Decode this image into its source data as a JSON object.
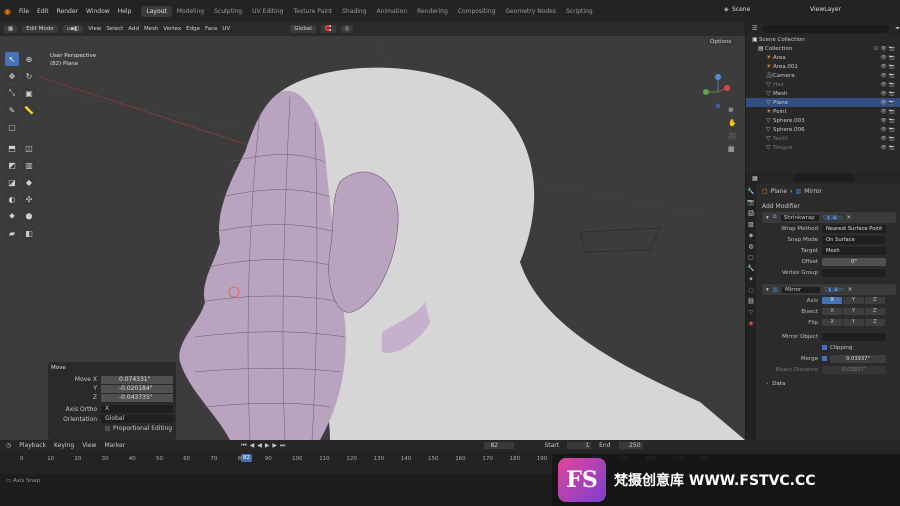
{
  "topbar": {
    "menus": [
      "File",
      "Edit",
      "Render",
      "Window",
      "Help"
    ],
    "workspaces": [
      "Layout",
      "Modeling",
      "Sculpting",
      "UV Editing",
      "Texture Paint",
      "Shading",
      "Animation",
      "Rendering",
      "Compositing",
      "Geometry Nodes",
      "Scripting"
    ],
    "active_workspace": "Layout",
    "scene_label": "Scene",
    "viewlayer_label": "ViewLayer"
  },
  "viewport": {
    "mode": "Edit Mode",
    "menus": [
      "View",
      "Select",
      "Add",
      "Mesh",
      "Vertex",
      "Edge",
      "Face",
      "UV"
    ],
    "orientation": "Global",
    "options_label": "Options",
    "view_name": "User Perspective",
    "object_name": "(82) Plane"
  },
  "operator_panel": {
    "title": "Move",
    "move_x_label": "Move X",
    "move_x": "0.074331\"",
    "y_label": "Y",
    "y": "-0.020184\"",
    "z_label": "Z",
    "z": "-0.043735\"",
    "axis_ortho_label": "Axis Ortho",
    "axis_ortho": "X",
    "orientation_label": "Orientation",
    "orientation": "Global",
    "proportional_label": "Proportional Editing"
  },
  "outliner": {
    "title": "Scene Collection",
    "collection": "Collection",
    "items": [
      {
        "name": "Area",
        "sel": false,
        "dim": false
      },
      {
        "name": "Area.001",
        "sel": false,
        "dim": false
      },
      {
        "name": "Camera",
        "sel": false,
        "dim": false
      },
      {
        "name": "Hair",
        "sel": false,
        "dim": true
      },
      {
        "name": "Mesh",
        "sel": false,
        "dim": false
      },
      {
        "name": "Plane",
        "sel": true,
        "dim": false
      },
      {
        "name": "Point",
        "sel": false,
        "dim": false
      },
      {
        "name": "Sphere.003",
        "sel": false,
        "dim": false
      },
      {
        "name": "Sphere.006",
        "sel": false,
        "dim": false
      },
      {
        "name": "Teeth",
        "sel": false,
        "dim": true
      },
      {
        "name": "Tongue",
        "sel": false,
        "dim": true
      }
    ]
  },
  "properties": {
    "breadcrumb_object": "Plane",
    "breadcrumb_modifier": "Mirror",
    "add_modifier": "Add Modifier",
    "shrinkwrap": {
      "name": "Shrinkwrap",
      "wrap_method_label": "Wrap Method",
      "wrap_method": "Nearest Surface Point",
      "snap_mode_label": "Snap Mode",
      "snap_mode": "On Surface",
      "target_label": "Target",
      "target": "Mesh",
      "offset_label": "Offset",
      "offset": "0\"",
      "vertex_group_label": "Vertex Group"
    },
    "mirror": {
      "name": "Mirror",
      "axis_label": "Axis",
      "bisect_label": "Bisect",
      "flip_label": "Flip",
      "axes": [
        "X",
        "Y",
        "Z"
      ],
      "mirror_object_label": "Mirror Object",
      "clipping_label": "Clipping",
      "merge_label": "Merge",
      "merge": "0.03937\"",
      "bisect_distance_label": "Bisect Distance",
      "bisect_distance": "0.03937\"",
      "data_label": "Data"
    }
  },
  "timeline": {
    "menus": [
      "Playback",
      "Keying",
      "View",
      "Marker"
    ],
    "current_frame": "82",
    "start_label": "Start",
    "start": "1",
    "end_label": "End",
    "end": "250",
    "ticks": [
      "0",
      "10",
      "20",
      "30",
      "40",
      "50",
      "60",
      "70",
      "80",
      "90",
      "100",
      "110",
      "120",
      "130",
      "140",
      "150",
      "160",
      "170",
      "180",
      "190",
      "200",
      "210",
      "220",
      "230",
      "240",
      "250"
    ]
  },
  "status": {
    "hint": "Axis Snap"
  },
  "watermark": {
    "logo": "FS",
    "text": "梵摄创意库 WWW.FSTVC.CC"
  },
  "colors": {
    "accent": "#4772b3",
    "selection": "#334d80",
    "mesh_face": "#b9a3bf",
    "head": "#d9d9d9"
  }
}
